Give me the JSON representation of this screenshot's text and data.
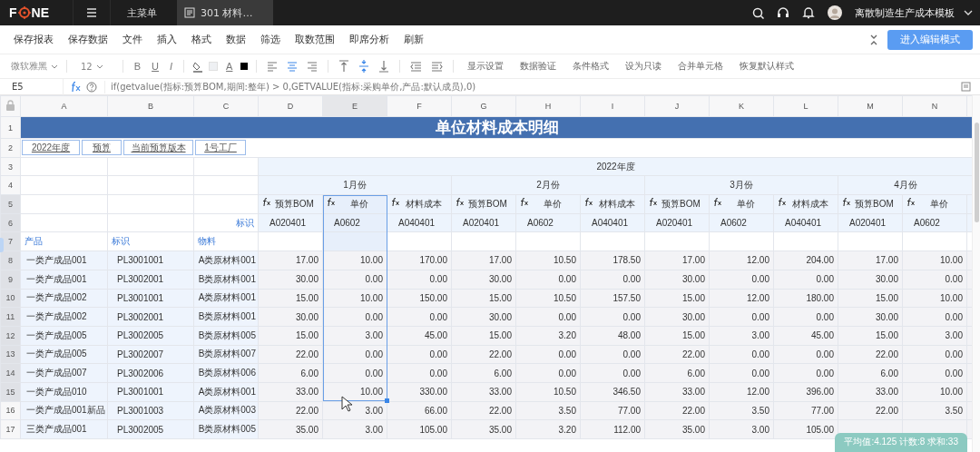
{
  "topbar": {
    "logo_left": "F",
    "logo_right": "NE",
    "tabs": [
      {
        "label": "主菜单",
        "selected": false
      },
      {
        "label": "301 材料…",
        "selected": true
      }
    ],
    "user": "离散制造生产成本模板"
  },
  "menu": [
    "保存报表",
    "保存数据",
    "文件",
    "插入",
    "格式",
    "数据",
    "筛选",
    "取数范围",
    "即席分析",
    "刷新"
  ],
  "edit_button": "进入编辑模式",
  "format_toolbar": {
    "font": "微软雅黑",
    "size": "12",
    "styles": [
      "B",
      "U",
      "I"
    ],
    "font_color_label": "A",
    "align": [
      {
        "kind": "left",
        "selected": false
      },
      {
        "kind": "center",
        "selected": true
      },
      {
        "kind": "right",
        "selected": false
      }
    ],
    "valign": [
      {
        "kind": "top",
        "selected": false
      },
      {
        "kind": "middle",
        "selected": true
      },
      {
        "kind": "bottom",
        "selected": false
      }
    ],
    "actions": [
      "显示设置",
      "数据验证",
      "条件格式",
      "设为只读",
      "合并单元格",
      "恢复默认样式"
    ]
  },
  "formula_bar": {
    "cell": "E5",
    "formula": "if(getvalue(指标:预算BOM,期间:整年) > 0,GETVALUE(指标:采购单价,产品:默认成员),0)"
  },
  "sheet": {
    "columns": [
      {
        "label": "A",
        "selected": false
      },
      {
        "label": "B",
        "selected": false
      },
      {
        "label": "C",
        "selected": false
      },
      {
        "label": "D",
        "selected": false
      },
      {
        "label": "E",
        "selected": true
      },
      {
        "label": "F",
        "selected": false
      },
      {
        "label": "G",
        "selected": false
      },
      {
        "label": "H",
        "selected": false
      },
      {
        "label": "I",
        "selected": false
      },
      {
        "label": "J",
        "selected": false
      },
      {
        "label": "K",
        "selected": false
      },
      {
        "label": "L",
        "selected": false
      },
      {
        "label": "M",
        "selected": false
      },
      {
        "label": "N",
        "selected": false
      }
    ],
    "row_numbers": [
      {
        "label": "1",
        "selected": false
      },
      {
        "label": "2",
        "selected": false
      },
      {
        "label": "3",
        "selected": false
      },
      {
        "label": "4",
        "selected": false
      },
      {
        "label": "5",
        "selected": true
      },
      {
        "label": "6",
        "selected": true
      },
      {
        "label": "7",
        "selected": true
      },
      {
        "label": "8",
        "selected": true
      },
      {
        "label": "9",
        "selected": true
      },
      {
        "label": "10",
        "selected": true
      },
      {
        "label": "11",
        "selected": true
      },
      {
        "label": "12",
        "selected": true
      },
      {
        "label": "13",
        "selected": true
      },
      {
        "label": "14",
        "selected": true
      },
      {
        "label": "15",
        "selected": true
      },
      {
        "label": "16",
        "selected": false
      },
      {
        "label": "17",
        "selected": false
      }
    ],
    "title": "单位材料成本明细",
    "filters": [
      "2022年度",
      "预算",
      "当前预算版本",
      "1号工厂"
    ],
    "year": "2022年度",
    "months": [
      "1月份",
      "2月份",
      "3月份",
      "4月份"
    ],
    "measures": [
      "预算BOM",
      "单价",
      "材料成本",
      "预算BOM",
      "单价",
      "材料成本",
      "预算BOM",
      "单价",
      "材料成本",
      "预算BOM",
      "单价"
    ],
    "codes": [
      "A020401",
      "A0602",
      "A040401",
      "A020401",
      "A0602",
      "A040401",
      "A020401",
      "A0602",
      "A040401",
      "A020401",
      "A0602"
    ],
    "row6_label": "标识",
    "row7_labels": [
      "产品",
      "标识",
      "物料"
    ],
    "rows": [
      {
        "cells": [
          "一类产成品001",
          "PL3001001",
          "A类原材料001",
          "17.00",
          "10.00",
          "170.00",
          "17.00",
          "10.50",
          "178.50",
          "17.00",
          "12.00",
          "204.00",
          "17.00",
          "10.00"
        ]
      },
      {
        "cells": [
          "一类产成品001",
          "PL3002001",
          "B类原材料001",
          "30.00",
          "0.00",
          "0.00",
          "30.00",
          "0.00",
          "0.00",
          "30.00",
          "0.00",
          "0.00",
          "30.00",
          "0.00"
        ]
      },
      {
        "cells": [
          "一类产成品002",
          "PL3001001",
          "A类原材料001",
          "15.00",
          "10.00",
          "150.00",
          "15.00",
          "10.50",
          "157.50",
          "15.00",
          "12.00",
          "180.00",
          "15.00",
          "10.00"
        ]
      },
      {
        "cells": [
          "一类产成品002",
          "PL3002001",
          "B类原材料001",
          "30.00",
          "0.00",
          "0.00",
          "30.00",
          "0.00",
          "0.00",
          "30.00",
          "0.00",
          "0.00",
          "30.00",
          "0.00"
        ]
      },
      {
        "cells": [
          "一类产成品005",
          "PL3002005",
          "B类原材料005",
          "15.00",
          "3.00",
          "45.00",
          "15.00",
          "3.20",
          "48.00",
          "15.00",
          "3.00",
          "45.00",
          "15.00",
          "3.00"
        ]
      },
      {
        "cells": [
          "一类产成品005",
          "PL3002007",
          "B类原材料007",
          "22.00",
          "0.00",
          "0.00",
          "22.00",
          "0.00",
          "0.00",
          "22.00",
          "0.00",
          "0.00",
          "22.00",
          "0.00"
        ]
      },
      {
        "cells": [
          "一类产成品007",
          "PL3002006",
          "B类原材料006",
          "6.00",
          "0.00",
          "0.00",
          "6.00",
          "0.00",
          "0.00",
          "6.00",
          "0.00",
          "0.00",
          "6.00",
          "0.00"
        ]
      },
      {
        "cells": [
          "一类产成品010",
          "PL3001001",
          "A类原材料001",
          "33.00",
          "10.00",
          "330.00",
          "33.00",
          "10.50",
          "346.50",
          "33.00",
          "12.00",
          "396.00",
          "33.00",
          "10.00"
        ]
      },
      {
        "cells": [
          "一类产成品001新品",
          "PL3001003",
          "A类原材料003",
          "22.00",
          "3.00",
          "66.00",
          "22.00",
          "3.50",
          "77.00",
          "22.00",
          "3.50",
          "77.00",
          "22.00",
          "3.50"
        ]
      },
      {
        "cells": [
          "三类产成品001",
          "PL3002005",
          "B类原材料005",
          "35.00",
          "3.00",
          "105.00",
          "35.00",
          "3.20",
          "112.00",
          "35.00",
          "3.00",
          "105.00"
        ]
      }
    ]
  },
  "status_summary": "平均值:4.125 计数:8 求和:33"
}
